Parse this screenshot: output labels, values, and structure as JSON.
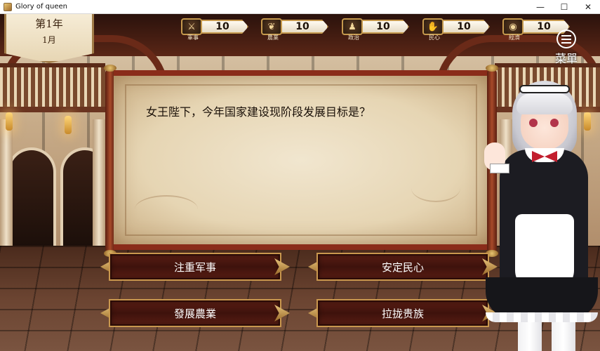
{
  "window": {
    "title": "Glory of queen",
    "controls": {
      "minimize": "—",
      "maximize": "☐",
      "close": "✕"
    }
  },
  "date": {
    "year": "第1年",
    "month": "1月"
  },
  "stats": [
    {
      "key": "military",
      "label": "軍事",
      "value": "10",
      "icon": "sword-icon"
    },
    {
      "key": "agriculture",
      "label": "農業",
      "value": "10",
      "icon": "wheat-icon"
    },
    {
      "key": "politics",
      "label": "政治",
      "value": "10",
      "icon": "bust-icon"
    },
    {
      "key": "people",
      "label": "民心",
      "value": "10",
      "icon": "handshake-icon"
    },
    {
      "key": "economy",
      "label": "經濟",
      "value": "10",
      "icon": "coin-icon"
    }
  ],
  "menu": {
    "label": "菜單"
  },
  "question": {
    "text": "女王陛下，今年国家建设现阶段发展目标是？"
  },
  "answers": [
    {
      "id": "military",
      "label": "注重军事"
    },
    {
      "id": "people",
      "label": "安定民心"
    },
    {
      "id": "agriculture",
      "label": "發展農業"
    },
    {
      "id": "nobles",
      "label": "拉拢贵族"
    }
  ],
  "colors": {
    "accent_gold": "#c9974e",
    "button_red": "#4a160e",
    "scroll_red": "#8a2c1a",
    "paper": "#efe3c9"
  }
}
